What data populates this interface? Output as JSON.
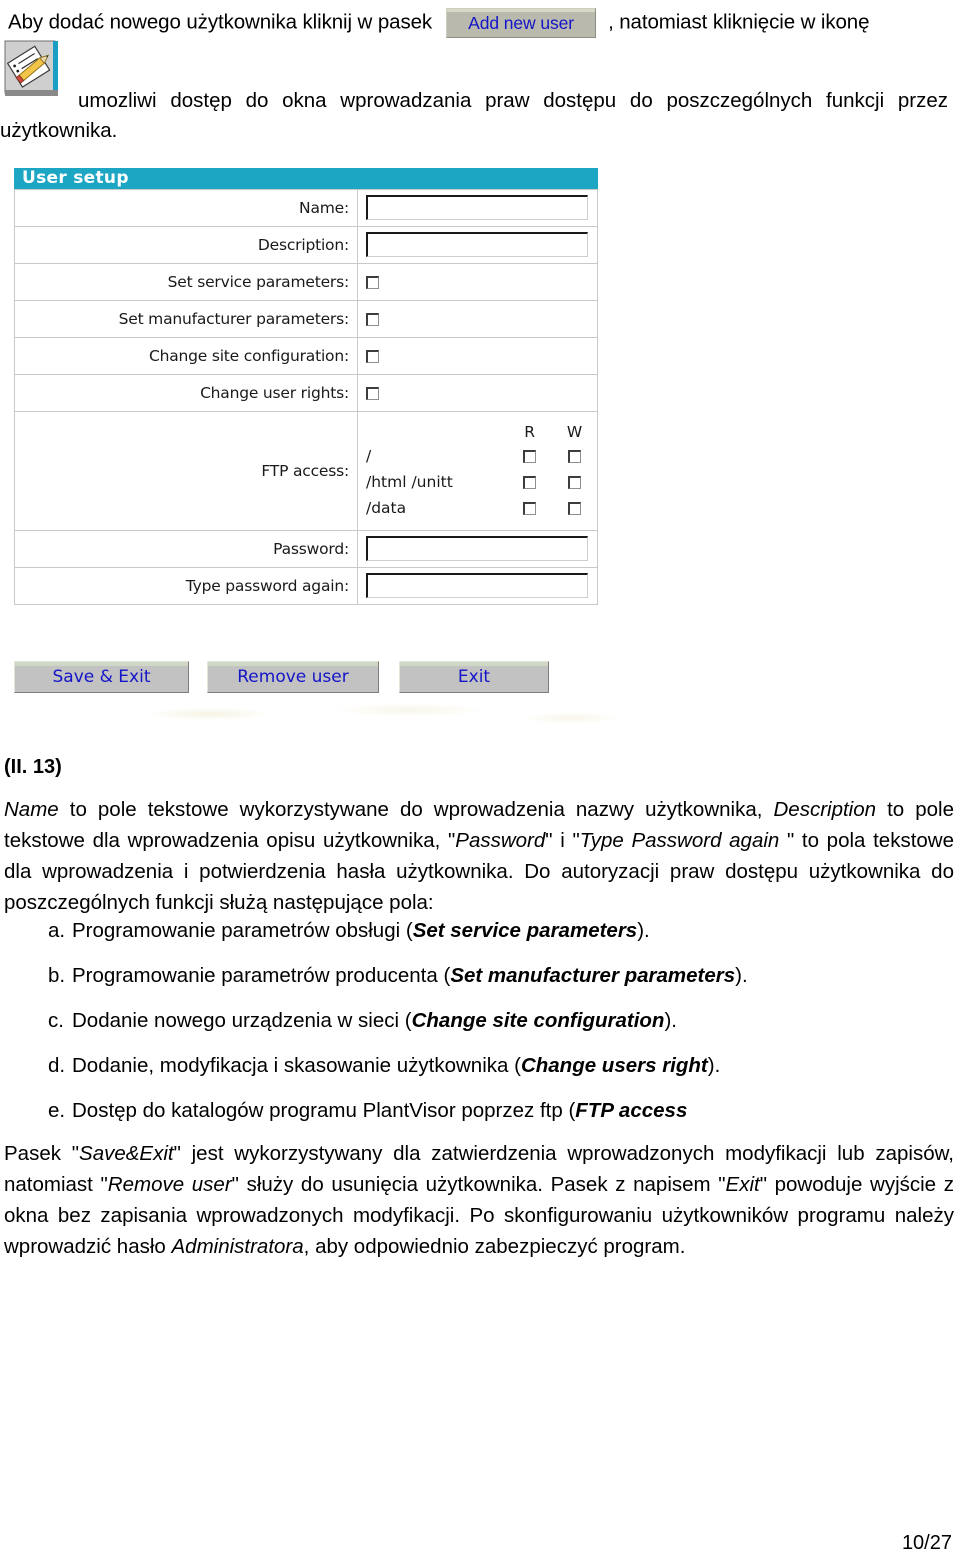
{
  "intro": {
    "line1_before": "Aby dodać nowego użytkownika kliknij w pasek",
    "add_new_user_button": "Add new user",
    "line1_after": ", natomiast kliknięcie w ikonę",
    "icon_name": "edit-user-rights-icon",
    "line2": "umozliwi dostęp do okna wprowadzania praw dostępu do poszczególnych funkcji przez",
    "line3": "użytkownika."
  },
  "dialog": {
    "title": "User setup",
    "rows": [
      {
        "label": "Name:",
        "type": "text",
        "value": ""
      },
      {
        "label": "Description:",
        "type": "text",
        "value": ""
      },
      {
        "label": "Set service parameters:",
        "type": "checkbox",
        "checked": false
      },
      {
        "label": "Set manufacturer parameters:",
        "type": "checkbox",
        "checked": false
      },
      {
        "label": "Change site configuration:",
        "type": "checkbox",
        "checked": false
      },
      {
        "label": "Change user rights:",
        "type": "checkbox",
        "checked": false
      }
    ],
    "ftp": {
      "label": "FTP access:",
      "col_read": "R",
      "col_write": "W",
      "paths": [
        {
          "path": "/",
          "read": false,
          "write": false
        },
        {
          "path": "/html /unitt",
          "read": false,
          "write": false
        },
        {
          "path": "/data",
          "read": false,
          "write": false
        }
      ]
    },
    "password_label": "Password:",
    "password_value": "",
    "password_again_label": "Type password again:",
    "password_again_value": "",
    "buttons": {
      "save": "Save & Exit",
      "remove": "Remove user",
      "exit": "Exit"
    },
    "colors": {
      "titlebar": "#1da5c4",
      "button_face": "#c2c2c2",
      "button_text": "#1414c8"
    }
  },
  "figure_caption": "(II. 13)",
  "paragraph_intro": {
    "s1": "Name",
    "s2": " to pole tekstowe wykorzystywane do wprowadzenia nazwy użytkownika, ",
    "s3": "Description",
    "s4": "  to pole tekstowe dla wprowadzenia opisu użytkownika, \"",
    "s5": "Password",
    "s6": "\" i \"",
    "s7": "Type Password again",
    "s8": " \" to pola tekstowe dla wprowadzenia i potwierdzenia hasła użytkownika. Do autoryzacji praw dostępu użytkownika do poszczególnych funkcji służą  następujące pola:"
  },
  "list_items": [
    {
      "mark": "a.",
      "text": "Programowanie parametrów obsługi (",
      "term": "Set service parameters",
      "tail": ")."
    },
    {
      "mark": "b.",
      "text": "Programowanie parametrów producenta (",
      "term": "Set manufacturer parameters",
      "tail": ")."
    },
    {
      "mark": "c.",
      "text": "Dodanie nowego urządzenia w sieci (",
      "term": "Change site configuration",
      "tail": ")."
    },
    {
      "mark": "d.",
      "text": "Dodanie, modyfikacja i skasowanie użytkownika (",
      "term": "Change users right",
      "tail": ")."
    },
    {
      "mark": "e.",
      "text": "Dostęp do katalogów programu PlantVisor poprzez ftp (",
      "term": "FTP access",
      "tail": ")"
    }
  ],
  "paragraph_final": {
    "s1": "Pasek \"",
    "s2": "Save&Exit",
    "s3": "\" jest wykorzystywany dla zatwierdzenia wprowadzonych modyfikacji lub zapisów, natomiast \"",
    "s4": "Remove user",
    "s5": "\" służy do usunięcia użytkownika. Pasek z napisem \"",
    "s6": "Exit",
    "s7": "\" powoduje wyjście z okna bez zapisania wprowadzonych modyfikacji. Po skonfigurowaniu użytkowników programu należy wprowadzić hasło ",
    "s8": "Administratora",
    "s9": ", aby odpowiednio zabezpieczyć program."
  },
  "page_number": "10/27"
}
